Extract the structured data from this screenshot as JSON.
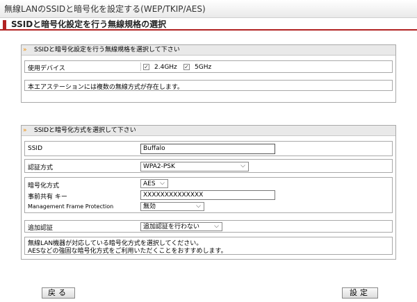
{
  "header": {
    "title": "無線LANのSSIDと暗号化を設定する(WEP/TKIP/AES)",
    "section_title": "SSIDと暗号化設定を行う無線規格の選択"
  },
  "panel1": {
    "title": "SSIDと暗号化設定を行う無線規格を選択して下さい",
    "device_label": "使用デバイス",
    "options": [
      {
        "label": "2.4GHz",
        "checked": true
      },
      {
        "label": "5GHz",
        "checked": true
      }
    ],
    "note": "本エアステーションには複数の無線方式が存在します。"
  },
  "panel2": {
    "title": "SSIDと暗号化方式を選択して下さい",
    "ssid_label": "SSID",
    "ssid_value": "Buffalo",
    "auth_label": "認証方式",
    "auth_value": "WPA2-PSK",
    "enc_label": "暗号化方式",
    "enc_value": "AES",
    "psk_label": "事前共有 キー",
    "psk_value": "XXXXXXXXXXXXXX",
    "mfp_label": "Management Frame Protection",
    "mfp_value": "無効",
    "addauth_label": "追加認証",
    "addauth_value": "追加認証を行わない",
    "note_line1": "無線LAN機器が対応している暗号化方式を選択してください。",
    "note_line2": "AESなどの強固な暗号化方式をご利用いただくことをおすすめします。"
  },
  "buttons": {
    "back": "戻る",
    "set": "設定"
  },
  "icons": {
    "check": "✓",
    "dropdown": "⌵",
    "section": "»"
  }
}
